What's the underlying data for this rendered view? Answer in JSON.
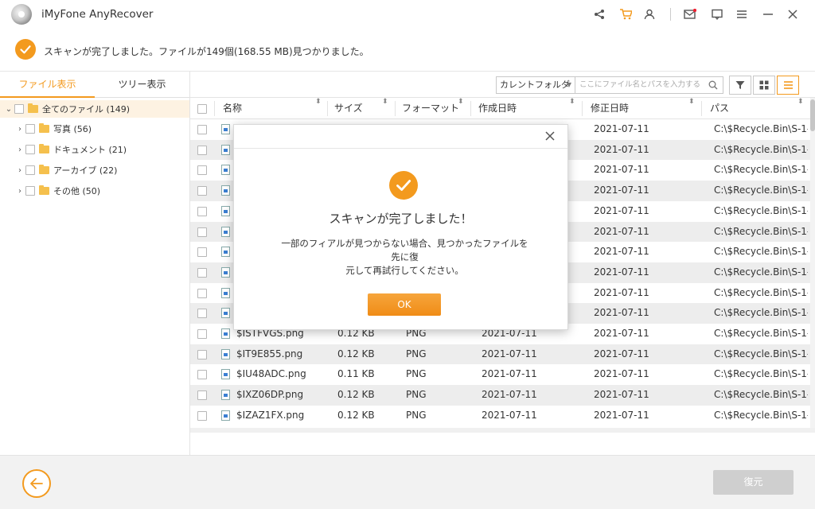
{
  "window": {
    "title": "iMyFone AnyRecover",
    "icons": [
      "share-icon",
      "cart-icon",
      "user-icon",
      "mail-icon",
      "feedback-icon",
      "menu-icon",
      "minimize-icon",
      "close-icon"
    ]
  },
  "status": {
    "message": "スキャンが完了しました。ファイルが149個(168.55 MB)見つかりました。"
  },
  "sidebar": {
    "tabs": [
      {
        "label": "ファイル表示",
        "active": true
      },
      {
        "label": "ツリー表示",
        "active": false
      }
    ],
    "tree": [
      {
        "label": "全てのファイル (149)",
        "level": 0,
        "expanded": true
      },
      {
        "label": "写真 (56)",
        "level": 1
      },
      {
        "label": "ドキュメント (21)",
        "level": 1
      },
      {
        "label": "アーカイブ (22)",
        "level": 1
      },
      {
        "label": "その他 (50)",
        "level": 1
      }
    ]
  },
  "toolbar": {
    "location_value": "カレントフォルダ",
    "search_placeholder": "ここにファイル名とパスを入力する"
  },
  "table": {
    "columns": [
      "名称",
      "サイズ",
      "フォーマット",
      "作成日時",
      "修正日時",
      "パス"
    ],
    "rows": [
      {
        "name": "",
        "size": "",
        "format": "",
        "created": "",
        "modified": "2021-07-11",
        "path": "C:\\$Recycle.Bin\\S-1-..."
      },
      {
        "name": "",
        "size": "",
        "format": "",
        "created": "",
        "modified": "2021-07-11",
        "path": "C:\\$Recycle.Bin\\S-1-..."
      },
      {
        "name": "",
        "size": "",
        "format": "",
        "created": "",
        "modified": "2021-07-11",
        "path": "C:\\$Recycle.Bin\\S-1-..."
      },
      {
        "name": "",
        "size": "",
        "format": "",
        "created": "",
        "modified": "2021-07-11",
        "path": "C:\\$Recycle.Bin\\S-1-..."
      },
      {
        "name": "",
        "size": "",
        "format": "",
        "created": "",
        "modified": "2021-07-11",
        "path": "C:\\$Recycle.Bin\\S-1-..."
      },
      {
        "name": "",
        "size": "",
        "format": "",
        "created": "",
        "modified": "2021-07-11",
        "path": "C:\\$Recycle.Bin\\S-1-..."
      },
      {
        "name": "",
        "size": "",
        "format": "",
        "created": "",
        "modified": "2021-07-11",
        "path": "C:\\$Recycle.Bin\\S-1-..."
      },
      {
        "name": "",
        "size": "",
        "format": "",
        "created": "",
        "modified": "2021-07-11",
        "path": "C:\\$Recycle.Bin\\S-1-..."
      },
      {
        "name": "",
        "size": "",
        "format": "",
        "created": "",
        "modified": "2021-07-11",
        "path": "C:\\$Recycle.Bin\\S-1-..."
      },
      {
        "name": "",
        "size": "",
        "format": "",
        "created": "",
        "modified": "2021-07-11",
        "path": "C:\\$Recycle.Bin\\S-1-..."
      },
      {
        "name": "$ISTFVGS.png",
        "size": "0.12 KB",
        "format": "PNG",
        "created": "2021-07-11",
        "modified": "2021-07-11",
        "path": "C:\\$Recycle.Bin\\S-1-..."
      },
      {
        "name": "$IT9E855.png",
        "size": "0.12 KB",
        "format": "PNG",
        "created": "2021-07-11",
        "modified": "2021-07-11",
        "path": "C:\\$Recycle.Bin\\S-1-..."
      },
      {
        "name": "$IU48ADC.png",
        "size": "0.11 KB",
        "format": "PNG",
        "created": "2021-07-11",
        "modified": "2021-07-11",
        "path": "C:\\$Recycle.Bin\\S-1-..."
      },
      {
        "name": "$IXZ06DP.png",
        "size": "0.12 KB",
        "format": "PNG",
        "created": "2021-07-11",
        "modified": "2021-07-11",
        "path": "C:\\$Recycle.Bin\\S-1-..."
      },
      {
        "name": "$IZAZ1FX.png",
        "size": "0.12 KB",
        "format": "PNG",
        "created": "2021-07-11",
        "modified": "2021-07-11",
        "path": "C:\\$Recycle.Bin\\S-1-..."
      }
    ]
  },
  "footer": {
    "recover_label": "復元"
  },
  "dialog": {
    "title": "スキャンが完了しました！",
    "message_line1": "一部のフィアルが見つからない場合、見つかったファイルを先に復",
    "message_line2": "元して再試行してください。",
    "ok_label": "OK"
  },
  "colors": {
    "accent": "#f39a1e",
    "row_alt": "#ededed",
    "disabled": "#cfcfcf"
  }
}
